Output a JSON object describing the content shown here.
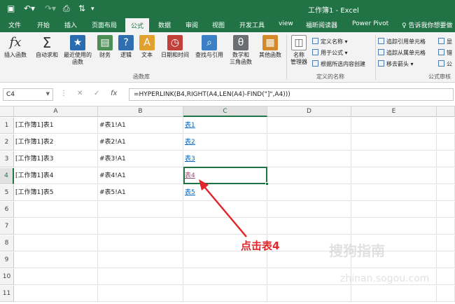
{
  "window": {
    "title": "工作簿1  -  Excel"
  },
  "tabs": [
    "文件",
    "开始",
    "插入",
    "页面布局",
    "公式",
    "数据",
    "审阅",
    "视图",
    "开发工具",
    "view",
    "福昕阅读器",
    "Power Pivot"
  ],
  "active_tab": "公式",
  "tell_me": "告诉我你想要做",
  "ribbon": {
    "function_library": {
      "label": "函数库",
      "insert_function": "插入函数",
      "autosum": "自动求和",
      "recent_line1": "最近使用的",
      "recent_line2": "函数",
      "financial": "财务",
      "logical": "逻辑",
      "text": "文本",
      "datetime": "日期和时间",
      "lookup": "查找与引用",
      "math_line1": "数学和",
      "math_line2": "三角函数",
      "more": "其他函数"
    },
    "defined_names": {
      "label": "定义的名称",
      "name_manager_line1": "名称",
      "name_manager_line2": "管理器",
      "define_name": "定义名称",
      "use_in_formula": "用于公式",
      "create_from_selection": "根据所选内容创建"
    },
    "formula_auditing": {
      "label": "公式审核",
      "trace_precedents": "追踪引用单元格",
      "trace_dependents": "追踪从属单元格",
      "remove_arrows": "移去箭头",
      "show": "显",
      "error": "错",
      "evaluate": "公"
    }
  },
  "name_box": "C4",
  "formula": "=HYPERLINK(B4,RIGHT(A4,LEN(A4)-FIND(\"]\",A4)))",
  "columns": [
    "A",
    "B",
    "C",
    "D",
    "E"
  ],
  "rows": [
    {
      "num": "1",
      "a": "[工作簿1]表1",
      "b": "#表1!A1",
      "c": "表1"
    },
    {
      "num": "2",
      "a": "[工作簿1]表2",
      "b": "#表2!A1",
      "c": "表2"
    },
    {
      "num": "3",
      "a": "[工作簿1]表3",
      "b": "#表3!A1",
      "c": "表3"
    },
    {
      "num": "4",
      "a": "[工作簿1]表4",
      "b": "#表4!A1",
      "c": "表4"
    },
    {
      "num": "5",
      "a": "[工作簿1]表5",
      "b": "#表5!A1",
      "c": "表5"
    },
    {
      "num": "6",
      "a": "",
      "b": "",
      "c": ""
    },
    {
      "num": "7",
      "a": "",
      "b": "",
      "c": ""
    },
    {
      "num": "8",
      "a": "",
      "b": "",
      "c": ""
    },
    {
      "num": "9",
      "a": "",
      "b": "",
      "c": ""
    },
    {
      "num": "10",
      "a": "",
      "b": "",
      "c": ""
    },
    {
      "num": "11",
      "a": "",
      "b": "",
      "c": ""
    }
  ],
  "annotation": "点击表4",
  "watermark": "搜狗指南",
  "watermark_url": "zhinan.sogou.com",
  "colors": {
    "excel_green": "#217346",
    "link": "#0563c1",
    "visited": "#954f72",
    "annotation_red": "#e0262b"
  }
}
